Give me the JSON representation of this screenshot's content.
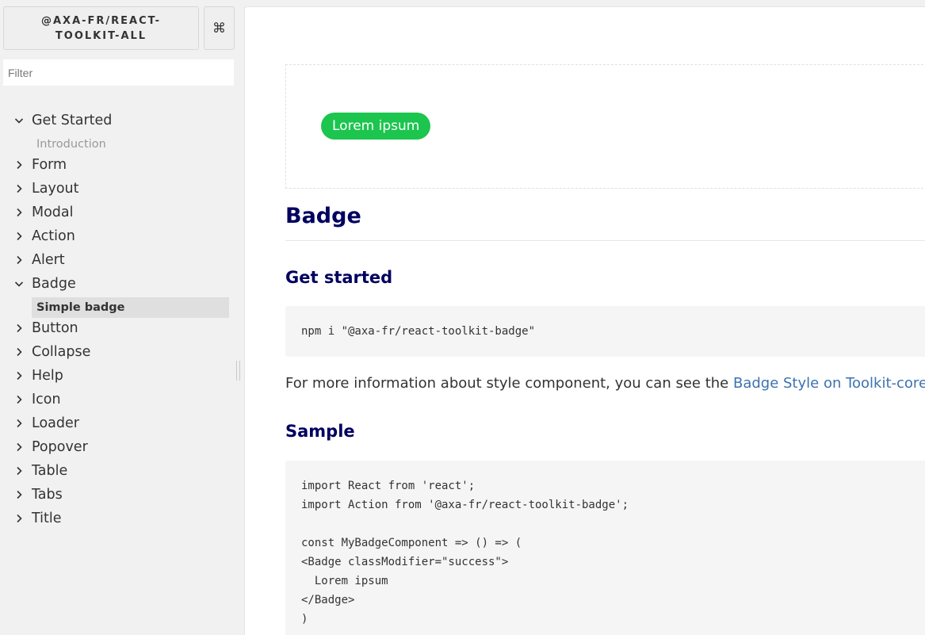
{
  "sidebar": {
    "brand": "@AXA-FR/REACT-TOOLKIT-ALL",
    "shortcut_symbol": "⌘",
    "filter_placeholder": "Filter",
    "nav": [
      {
        "label": "Get Started",
        "expanded": true
      },
      {
        "label": "Form",
        "expanded": false
      },
      {
        "label": "Layout",
        "expanded": false
      },
      {
        "label": "Modal",
        "expanded": false
      },
      {
        "label": "Action",
        "expanded": false
      },
      {
        "label": "Alert",
        "expanded": false
      },
      {
        "label": "Badge",
        "expanded": true
      },
      {
        "label": "Button",
        "expanded": false
      },
      {
        "label": "Collapse",
        "expanded": false
      },
      {
        "label": "Help",
        "expanded": false
      },
      {
        "label": "Icon",
        "expanded": false
      },
      {
        "label": "Loader",
        "expanded": false
      },
      {
        "label": "Popover",
        "expanded": false
      },
      {
        "label": "Table",
        "expanded": false
      },
      {
        "label": "Tabs",
        "expanded": false
      },
      {
        "label": "Title",
        "expanded": false
      }
    ],
    "sub_intro": "Introduction",
    "sub_simple_badge": "Simple badge"
  },
  "content": {
    "badge_text": "Lorem ipsum",
    "badge_color": "#1cc54e",
    "title": "Badge",
    "get_started_heading": "Get started",
    "install_cmd": "npm i \"@axa-fr/react-toolkit-badge\"",
    "info_text": "For more information about style component, you can see the ",
    "info_link": "Badge Style on Toolkit-core",
    "sample_heading": "Sample",
    "sample_code": [
      "import React from 'react';",
      "import Action from '@axa-fr/react-toolkit-badge';",
      "",
      "const MyBadgeComponent => () => (",
      "<Badge classModifier=\"success\">",
      "  Lorem ipsum",
      "</Badge>",
      ")"
    ]
  },
  "colors": {
    "heading": "#000060",
    "link": "#3c72b0"
  }
}
